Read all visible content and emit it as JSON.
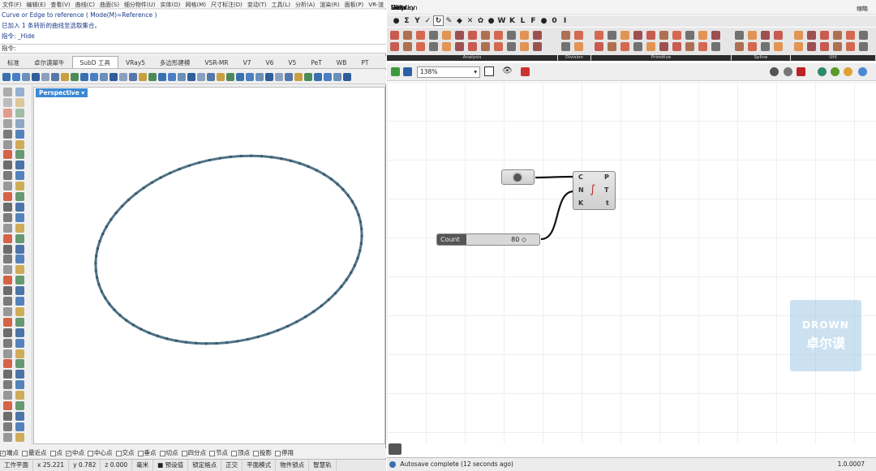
{
  "rhino": {
    "menu": [
      "文件(F)",
      "编辑(E)",
      "查看(V)",
      "曲线(C)",
      "曲面(S)",
      "细分物件(U)",
      "实体(O)",
      "网格(M)",
      "尺寸标注(D)",
      "变动(T)",
      "工具(L)",
      "分析(A)",
      "渲染(R)",
      "面板(P)",
      "VR-渲"
    ],
    "history": [
      "Curve or Edge to reference ( Mode(M)=Reference )",
      "已加入 1 条转折的曲线至选取集合。",
      "指令: _Hide"
    ],
    "prompt": "指令:",
    "tabs": [
      "标准",
      "卓尔谟犀牛",
      "SubD 工具",
      "VRay5",
      "多边形建模",
      "VSR-MR",
      "V7",
      "V6",
      "V5",
      "PeT",
      "WB",
      "PT"
    ],
    "active_tab": "SubD 工具",
    "viewport_name": "Perspective",
    "osnaps": [
      {
        "label": "端点",
        "on": true
      },
      {
        "label": "最近点",
        "on": false
      },
      {
        "label": "点",
        "on": false
      },
      {
        "label": "中点",
        "on": true
      },
      {
        "label": "中心点",
        "on": false
      },
      {
        "label": "交点",
        "on": false
      },
      {
        "label": "垂点",
        "on": false
      },
      {
        "label": "切点",
        "on": false
      },
      {
        "label": "四分点",
        "on": false
      },
      {
        "label": "节点",
        "on": false
      },
      {
        "label": "顶点",
        "on": false
      },
      {
        "label": "投影",
        "on": false
      },
      {
        "label": "停用",
        "on": false
      }
    ],
    "status": [
      "工作平面",
      "x 25.221",
      "y 0.782",
      "z 0.000",
      "毫米",
      "■ 预设值",
      "锁定格点",
      "正交",
      "平面模式",
      "物件锁点",
      "智慧轨"
    ]
  },
  "grasshopper": {
    "menu": [
      "File",
      "Edit",
      "View",
      "Display",
      "Solution",
      "Help"
    ],
    "title_right": "缩略",
    "tabs": [
      "●",
      "Σ",
      "Y",
      "✓",
      "↻",
      "✎",
      "◆",
      "✕",
      "✿",
      "●",
      "W",
      "K",
      "L",
      "F",
      "●",
      "0",
      "I"
    ],
    "active_tab_index": 4,
    "groups": [
      "Analysis",
      "Division",
      "Primitive",
      "Spline",
      "Util"
    ],
    "zoom": "138%",
    "component": {
      "inputs": [
        "C",
        "N",
        "K"
      ],
      "outputs": [
        "P",
        "T",
        "t"
      ]
    },
    "slider": {
      "label": "Count",
      "value": "80 ◇"
    },
    "footer": "Autosave complete (12 seconds ago)",
    "version": "1.0.0007",
    "watermark": {
      "line1": "DROWN",
      "line2": "卓尔谟"
    }
  },
  "colors": {
    "curve": "#4f7388",
    "viewport_tab": "#3b89d4",
    "accent_orange": "#e08030"
  }
}
